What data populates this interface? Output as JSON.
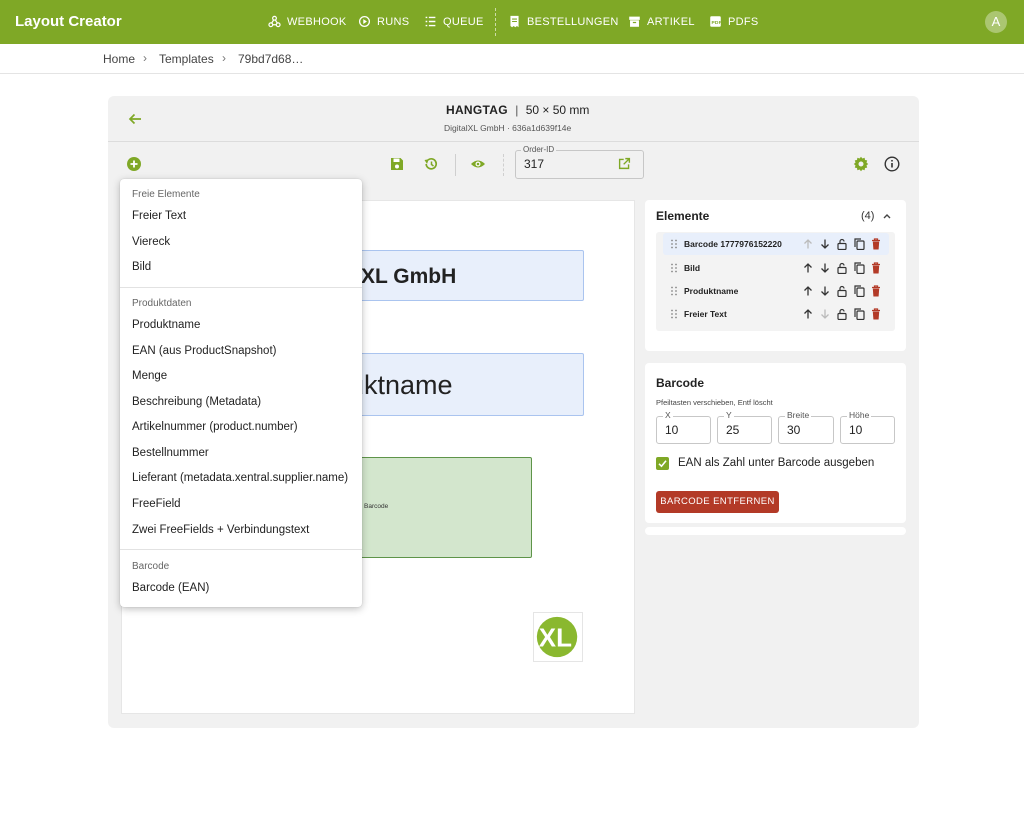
{
  "app": {
    "title": "Layout Creator",
    "avatar_initial": "A"
  },
  "nav": [
    {
      "label": "WEBHOOK",
      "icon": "webhook-icon"
    },
    {
      "label": "RUNS",
      "icon": "runs-icon"
    },
    {
      "label": "QUEUE",
      "icon": "queue-icon"
    },
    {
      "label": "BESTELLUNGEN",
      "icon": "receipt-icon"
    },
    {
      "label": "ARTIKEL",
      "icon": "archive-icon"
    },
    {
      "label": "PDFS",
      "icon": "pdf-icon"
    }
  ],
  "breadcrumb": {
    "home": "Home",
    "templates": "Templates",
    "current": "79bd7d68…"
  },
  "document": {
    "type": "HANGTAG",
    "separator": "|",
    "size": "50 × 50 mm",
    "subtitle": "DigitalXL GmbH · 636a1d639f14e"
  },
  "toolbar": {
    "order_label": "Order-ID",
    "order_value": "317"
  },
  "canvas": {
    "text1": "XL GmbH",
    "text2": "uktname",
    "barcode_label": "Barcode",
    "logo_text": "XL"
  },
  "menu": {
    "sections": [
      {
        "header": "Freie Elemente",
        "items": [
          "Freier Text",
          "Viereck",
          "Bild"
        ]
      },
      {
        "header": "Produktdaten",
        "items": [
          "Produktname",
          "EAN (aus ProductSnapshot)",
          "Menge",
          "Beschreibung (Metadata)",
          "Artikelnummer (product.number)",
          "Bestellnummer",
          "Lieferant (metadata.xentral.supplier.name)",
          "FreeField",
          "Zwei FreeFields + Verbindungstext"
        ]
      },
      {
        "header": "Barcode",
        "items": [
          "Barcode (EAN)"
        ]
      }
    ]
  },
  "elements_panel": {
    "title": "Elemente",
    "count": "(4)",
    "items": [
      "Barcode 1777976152220",
      "Bild",
      "Produktname",
      "Freier Text"
    ]
  },
  "props_panel": {
    "title": "Barcode",
    "hint": "Pfeiltasten verschieben, Entf löscht",
    "fields": [
      {
        "label": "X",
        "value": "10"
      },
      {
        "label": "Y",
        "value": "25"
      },
      {
        "label": "Breite",
        "value": "30"
      },
      {
        "label": "Höhe",
        "value": "10"
      }
    ],
    "checkbox_label": "EAN als Zahl unter Barcode ausgeben",
    "checkbox_checked": true,
    "remove_button": "BARCODE ENTFERNEN"
  },
  "colors": {
    "brand": "#7fa826",
    "danger": "#b33a27",
    "selection": "#e8effb",
    "barcode_fill": "#d3e6cd"
  }
}
